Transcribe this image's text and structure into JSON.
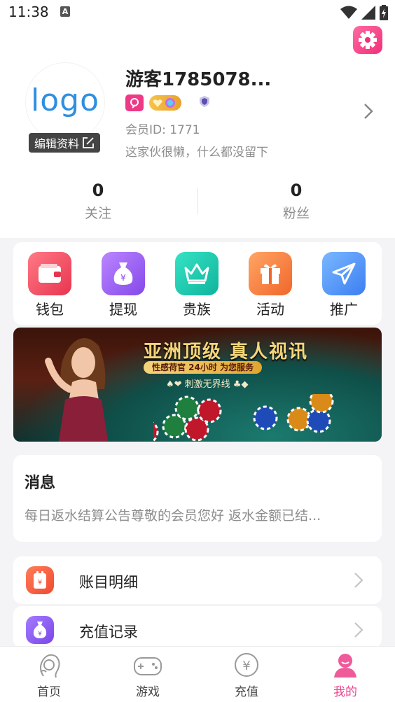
{
  "status_bar": {
    "time": "11:38",
    "notif_glyph": "A"
  },
  "profile": {
    "avatar_text": "logo",
    "edit_label": "编辑资料",
    "username": "游客1785078...",
    "member_id": "会员ID: 1771",
    "bio": "这家伙很懒，什么都没留下"
  },
  "stats": {
    "following_count": "0",
    "following_label": "关注",
    "fans_count": "0",
    "fans_label": "粉丝"
  },
  "quick_actions": [
    {
      "label": "钱包",
      "icon": "wallet-icon",
      "color": "#f0506a"
    },
    {
      "label": "提现",
      "icon": "money-bag-icon",
      "color": "#9a5cf2"
    },
    {
      "label": "贵族",
      "icon": "crown-icon",
      "color": "#14c9b2"
    },
    {
      "label": "活动",
      "icon": "gift-icon",
      "color": "#fb8a3c"
    },
    {
      "label": "推广",
      "icon": "paper-plane-icon",
      "color": "#4a8cf5"
    }
  ],
  "banner": {
    "title": "亚洲顶级 真人视讯",
    "line1": "性感荷官  24小时 为您服务",
    "line2": "♠❤ 刺激无界线 ♣◆"
  },
  "messages": {
    "title": "消息",
    "preview": "每日返水结算公告尊敬的会员您好  返水金额已结..."
  },
  "menu": [
    {
      "label": "账目明细",
      "icon": "ledger-icon",
      "color": "#fb5a3c"
    },
    {
      "label": "充值记录",
      "icon": "money-bag-icon",
      "color": "#8a54ef"
    }
  ],
  "tabs": [
    {
      "label": "首页",
      "icon": "home-girl-icon"
    },
    {
      "label": "游戏",
      "icon": "gamepad-icon"
    },
    {
      "label": "充值",
      "icon": "yuan-coin-icon"
    },
    {
      "label": "我的",
      "icon": "user-icon",
      "active": true
    }
  ],
  "colors": {
    "accent": "#e9468e",
    "muted": "#8d8d8d"
  }
}
